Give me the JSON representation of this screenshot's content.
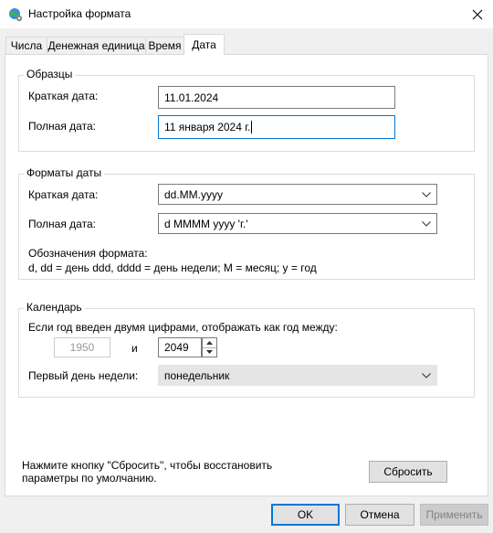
{
  "window": {
    "title": "Настройка формата",
    "icon": "globe-gear-icon",
    "close_icon": "close-icon"
  },
  "tabs": [
    {
      "label": "Числа",
      "active": false
    },
    {
      "label": "Денежная единица",
      "active": false
    },
    {
      "label": "Время",
      "active": false
    },
    {
      "label": "Дата",
      "active": true
    }
  ],
  "samples": {
    "legend": "Образцы",
    "short_label": "Краткая дата:",
    "short_value": "11.01.2024",
    "long_label": "Полная дата:",
    "long_value": "11 января 2024 г."
  },
  "formats": {
    "legend": "Форматы даты",
    "short_label": "Краткая дата:",
    "short_value": "dd.MM.yyyy",
    "long_label": "Полная дата:",
    "long_value": "d MMMM yyyy 'г.'",
    "notation_title": "Обозначения формата:",
    "notation_text": "d, dd = день  ddd, dddd = день недели; M = месяц; y = год"
  },
  "calendar": {
    "legend": "Календарь",
    "two_digit_label": "Если год введен двумя цифрами, отображать как год между:",
    "year_from": "1950",
    "and_label": "и",
    "year_to": "2049",
    "first_day_label": "Первый день недели:",
    "first_day_value": "понедельник"
  },
  "reset": {
    "hint": "Нажмите кнопку \"Сбросить\", чтобы восстановить параметры по умолчанию.",
    "button": "Сбросить"
  },
  "footer": {
    "ok": "OK",
    "cancel": "Отмена",
    "apply": "Применить"
  },
  "colors": {
    "accent": "#0078d7",
    "window_bg": "#f0f0f0",
    "page_bg": "#ffffff"
  }
}
